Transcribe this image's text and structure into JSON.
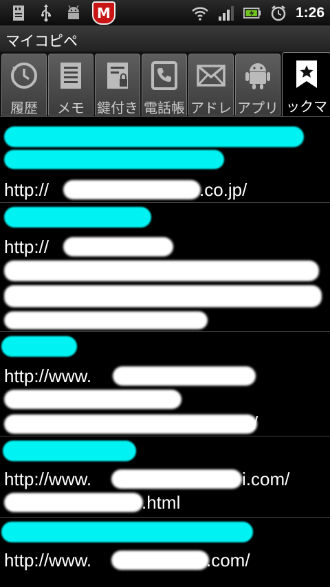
{
  "status_bar": {
    "time": "1:26",
    "left_icons": [
      "sd-card-icon",
      "usb-icon",
      "android-debug-icon",
      "mcafee-shield-icon"
    ],
    "right_icons": [
      "wifi-icon",
      "signal-icon",
      "battery-icon",
      "alarm-icon"
    ],
    "mcafee_letter": "M"
  },
  "title": "マイコピペ",
  "tabs": [
    {
      "label": "履歴",
      "icon": "history-clock-icon",
      "active": false
    },
    {
      "label": "メモ",
      "icon": "memo-icon",
      "active": false
    },
    {
      "label": "鍵付き",
      "icon": "locked-memo-icon",
      "active": false
    },
    {
      "label": "電話帳",
      "icon": "phone-book-icon",
      "active": false
    },
    {
      "label": "アドレ",
      "icon": "mail-envelope-icon",
      "active": false
    },
    {
      "label": "アプリ",
      "icon": "android-app-icon",
      "active": false
    },
    {
      "label": "ックマ",
      "icon": "bookmark-star-icon",
      "active": true
    }
  ],
  "bookmarks": [
    {
      "url_lines": [
        "http://",
        ".co.jp/"
      ]
    },
    {
      "url_lines": [
        "http://"
      ]
    },
    {
      "url_lines": [
        "http://www.",
        "/"
      ]
    },
    {
      "url_lines": [
        "http://www.",
        "i.com/",
        ".html"
      ]
    },
    {
      "url_lines": [
        "http://www.",
        ".com/"
      ]
    }
  ],
  "colors": {
    "redaction_title": "#00f2f2",
    "redaction_url": "#ffffff",
    "background": "#000000"
  }
}
